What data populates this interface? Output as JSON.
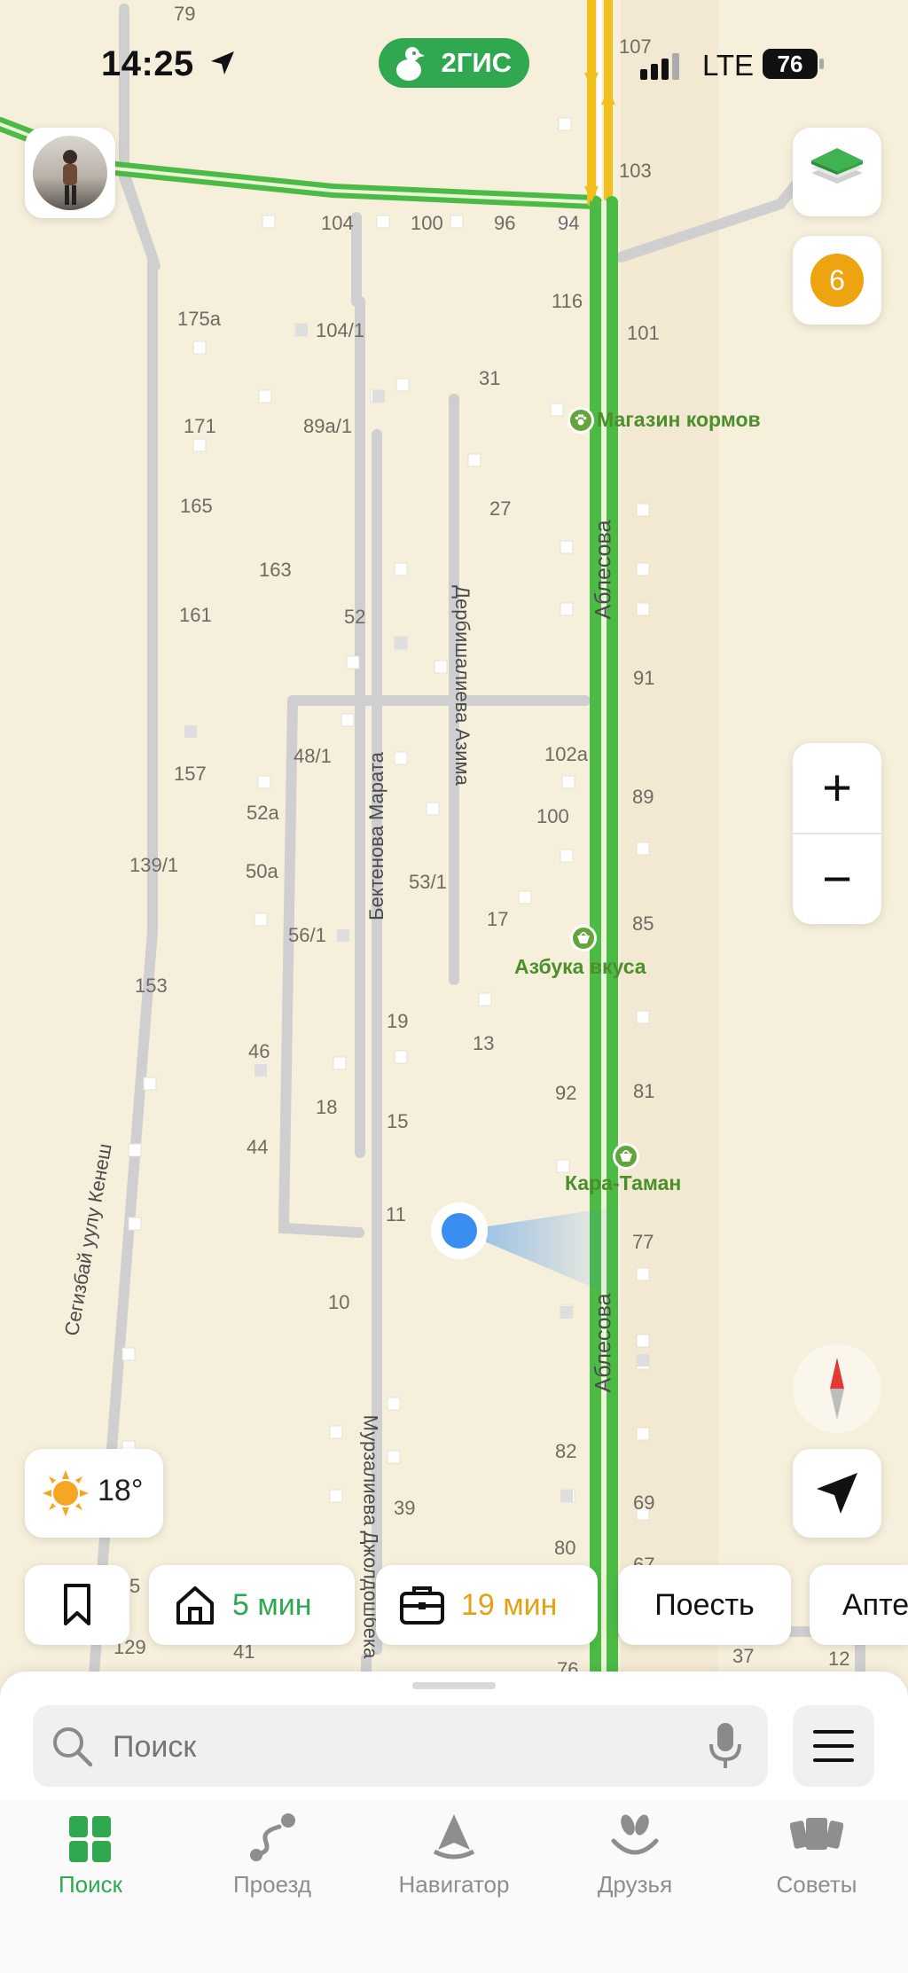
{
  "status_bar": {
    "time": "14:25",
    "network": "LTE",
    "battery": "76"
  },
  "brand": {
    "name": "2ГИС"
  },
  "map": {
    "streets": [
      "Аблесова",
      "Аблесова",
      "Дербишалиева Азима",
      "Бектенова Марата",
      "Мурзалиева Джолдошбека",
      "Сегизбай уулу Кенеш"
    ],
    "house_numbers": [
      "79",
      "107",
      "103",
      "104",
      "100",
      "96",
      "94",
      "116",
      "101",
      "175а",
      "104/1",
      "31",
      "171",
      "89а/1",
      "165",
      "27",
      "163",
      "161",
      "52",
      "91",
      "157",
      "48/1",
      "102а",
      "89",
      "52а",
      "100",
      "139/1",
      "50а",
      "53/1",
      "17",
      "85",
      "56/1",
      "153",
      "19",
      "13",
      "46",
      "92",
      "81",
      "18",
      "15",
      "44",
      "11",
      "77",
      "10",
      "82",
      "69",
      "39",
      "80",
      "67",
      "5",
      "129",
      "41",
      "76",
      "37",
      "12"
    ],
    "pois": [
      "Магазин кормов",
      "Азбука вкуса",
      "Кара-Таман"
    ]
  },
  "controls": {
    "badge_count": "6",
    "zoom_in": "+",
    "zoom_out": "−",
    "weather_temp": "18°"
  },
  "chips": {
    "home_time": "5 мин",
    "work_time": "19 мин",
    "eat": "Поесть",
    "pharmacy": "Апте"
  },
  "search": {
    "placeholder": "Поиск"
  },
  "tabs": [
    {
      "label": "Поиск",
      "icon": "grid-icon"
    },
    {
      "label": "Проезд",
      "icon": "route-icon"
    },
    {
      "label": "Навигатор",
      "icon": "navigator-icon"
    },
    {
      "label": "Друзья",
      "icon": "friends-icon"
    },
    {
      "label": "Советы",
      "icon": "tips-icon"
    }
  ],
  "colors": {
    "brand_green": "#2fa84f",
    "road_green": "#4cbb45",
    "road_yellow": "#f2c01c",
    "work_orange": "#e3a114",
    "location_blue": "#3a8ef0"
  }
}
